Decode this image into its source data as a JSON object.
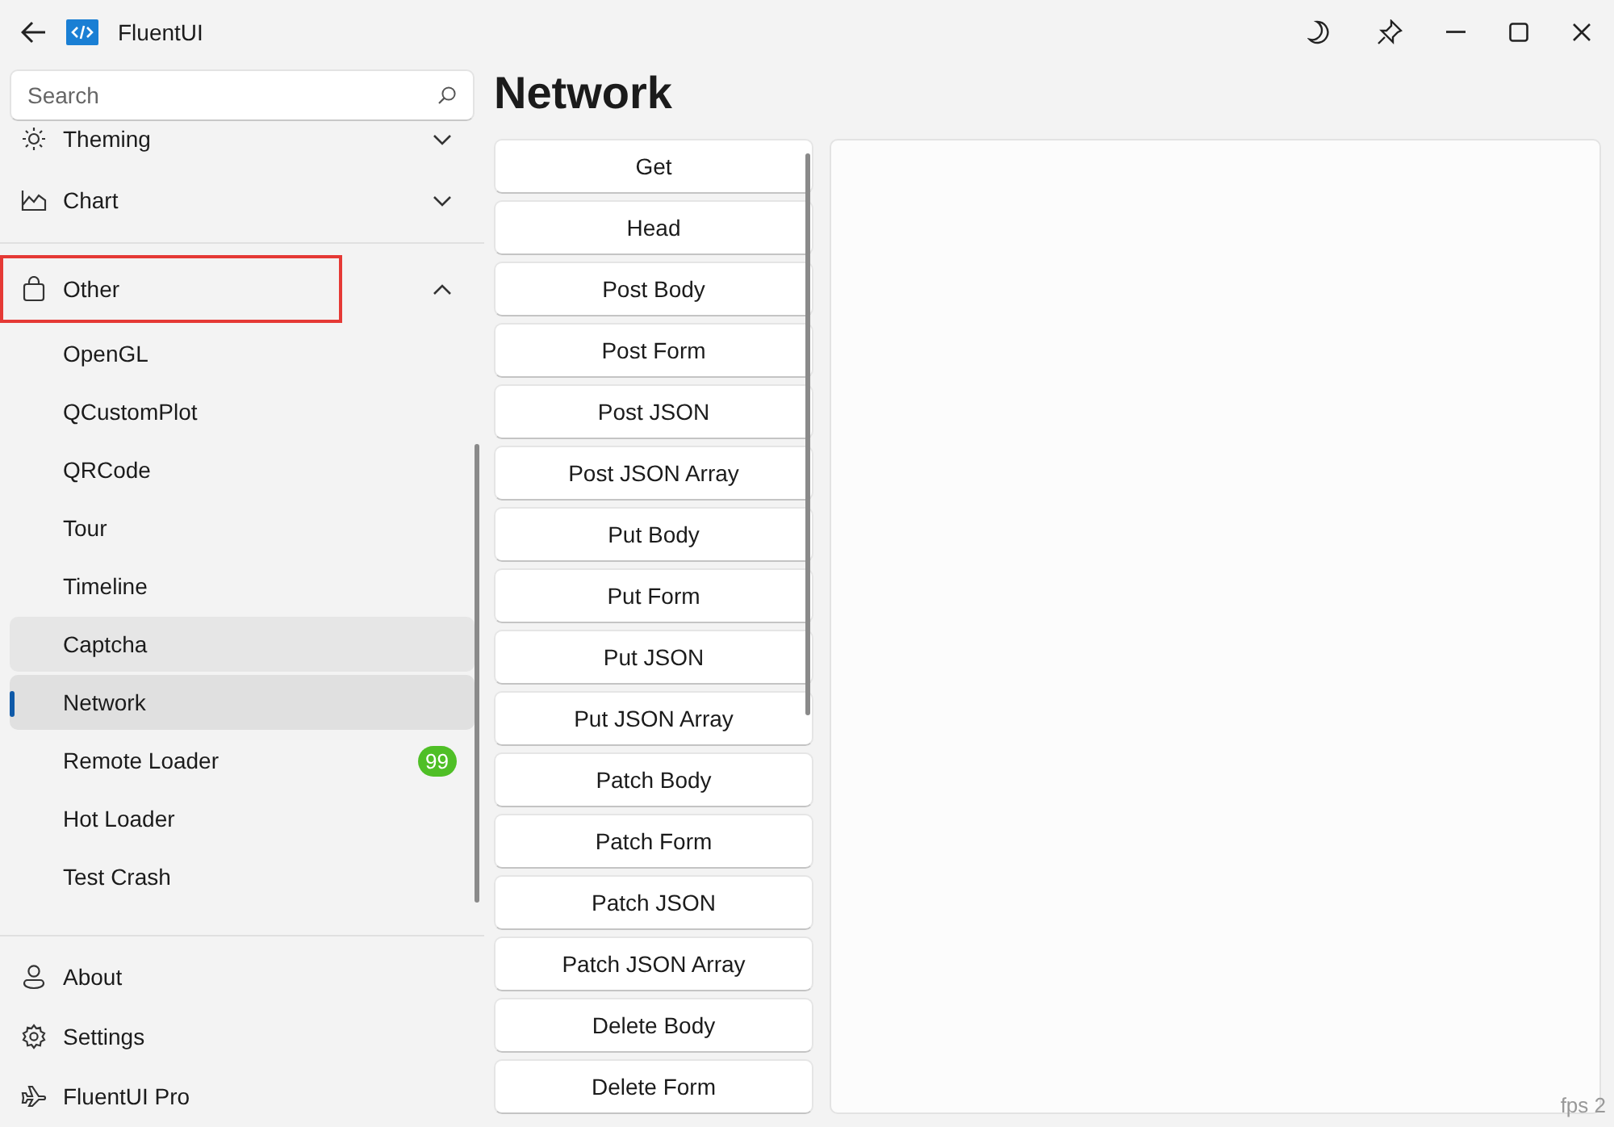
{
  "window": {
    "title": "FluentUI"
  },
  "search": {
    "placeholder": "Search"
  },
  "nav": [
    {
      "label": "Theming",
      "expanded": false,
      "highlighted": false
    },
    {
      "label": "Chart",
      "expanded": false,
      "highlighted": false
    },
    {
      "label": "Other",
      "expanded": true,
      "highlighted": true,
      "children": [
        {
          "label": "OpenGL",
          "selected": false,
          "hovered": false
        },
        {
          "label": "QCustomPlot",
          "selected": false,
          "hovered": false
        },
        {
          "label": "QRCode",
          "selected": false,
          "hovered": false
        },
        {
          "label": "Tour",
          "selected": false,
          "hovered": false
        },
        {
          "label": "Timeline",
          "selected": false,
          "hovered": false
        },
        {
          "label": "Captcha",
          "selected": false,
          "hovered": true
        },
        {
          "label": "Network",
          "selected": true,
          "hovered": false
        },
        {
          "label": "Remote Loader",
          "selected": false,
          "hovered": false,
          "badge": "99"
        },
        {
          "label": "Hot Loader",
          "selected": false,
          "hovered": false
        },
        {
          "label": "Test Crash",
          "selected": false,
          "hovered": false
        }
      ]
    }
  ],
  "footer_nav": [
    {
      "label": "About"
    },
    {
      "label": "Settings"
    },
    {
      "label": "FluentUI Pro"
    }
  ],
  "page": {
    "title": "Network",
    "buttons": [
      "Get",
      "Head",
      "Post Body",
      "Post Form",
      "Post JSON",
      "Post JSON Array",
      "Put Body",
      "Put Form",
      "Put JSON",
      "Put JSON Array",
      "Patch Body",
      "Patch Form",
      "Patch JSON",
      "Patch JSON Array",
      "Delete Body",
      "Delete Form"
    ],
    "fps": "fps 2"
  }
}
